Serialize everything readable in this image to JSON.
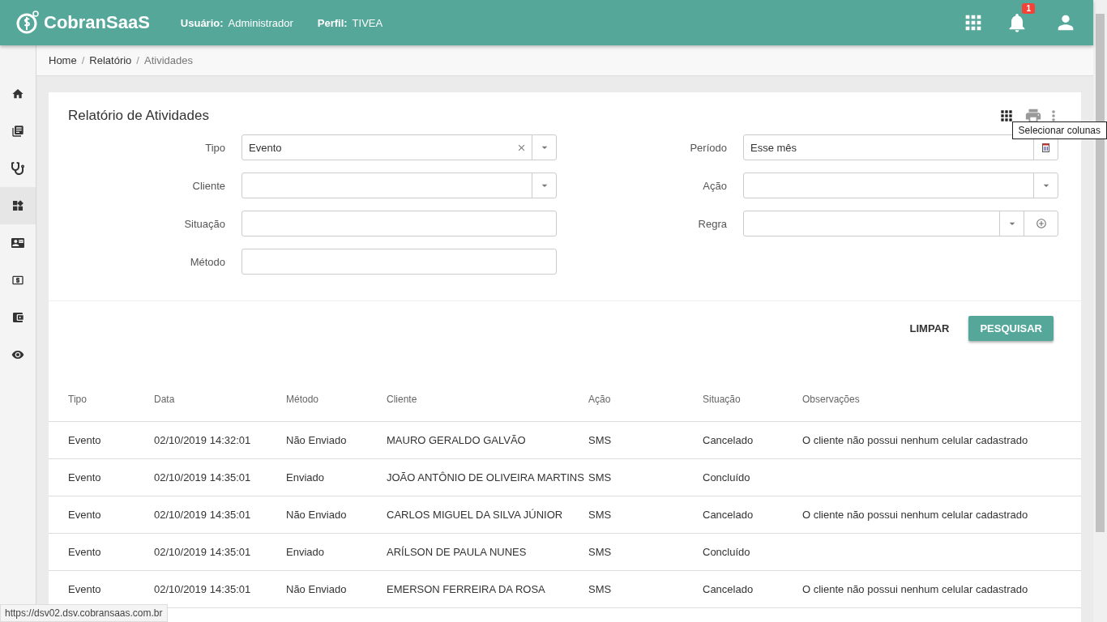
{
  "header": {
    "brand": "CobranSaaS",
    "user_label": "Usuário:",
    "user_value": "Administrador",
    "profile_label": "Perfil:",
    "profile_value": "TIVEA",
    "notification_count": "1"
  },
  "sidebar": {
    "items": [
      {
        "kind": "home",
        "selected": false
      },
      {
        "kind": "books",
        "selected": false
      },
      {
        "kind": "stethoscope",
        "selected": false
      },
      {
        "kind": "widgets",
        "selected": true
      },
      {
        "kind": "contact",
        "selected": false
      },
      {
        "kind": "money",
        "selected": false
      },
      {
        "kind": "wallet",
        "selected": false
      },
      {
        "kind": "eye",
        "selected": false
      }
    ]
  },
  "breadcrumb": {
    "separator": "/",
    "items": [
      "Home",
      "Relatório",
      "Atividades"
    ]
  },
  "card": {
    "title": "Relatório de Atividades",
    "tooltip": "Selecionar colunas"
  },
  "filters_left": [
    {
      "label": "Tipo",
      "kind": "select",
      "value": "Evento",
      "clearable": true
    },
    {
      "label": "Cliente",
      "kind": "select"
    },
    {
      "label": "Situação",
      "kind": "text"
    },
    {
      "label": "Método",
      "kind": "text"
    }
  ],
  "filters_right": [
    {
      "label": "Período",
      "kind": "date",
      "value": "Esse mês"
    },
    {
      "label": "Ação",
      "kind": "select"
    },
    {
      "label": "Regra",
      "kind": "select-add"
    }
  ],
  "buttons": {
    "clear": "LIMPAR",
    "search": "PESQUISAR"
  },
  "table": {
    "columns": [
      "Tipo",
      "Data",
      "Método",
      "Cliente",
      "Ação",
      "Situação",
      "Observações"
    ],
    "rows": [
      [
        "Evento",
        "02/10/2019 14:32:01",
        "Não Enviado",
        "MAURO GERALDO GALVÃO",
        "SMS",
        "Cancelado",
        "O cliente não possui nenhum celular cadastrado"
      ],
      [
        "Evento",
        "02/10/2019 14:35:01",
        "Enviado",
        "JOÃO ANTÔNIO DE OLIVEIRA MARTINS",
        "SMS",
        "Concluído",
        ""
      ],
      [
        "Evento",
        "02/10/2019 14:35:01",
        "Não Enviado",
        "CARLOS MIGUEL DA SILVA JÚNIOR",
        "SMS",
        "Cancelado",
        "O cliente não possui nenhum celular cadastrado"
      ],
      [
        "Evento",
        "02/10/2019 14:35:01",
        "Enviado",
        "ARÍLSON DE PAULA NUNES",
        "SMS",
        "Concluído",
        ""
      ],
      [
        "Evento",
        "02/10/2019 14:35:01",
        "Não Enviado",
        "EMERSON FERREIRA DA ROSA",
        "SMS",
        "Cancelado",
        "O cliente não possui nenhum celular cadastrado"
      ]
    ]
  },
  "status_url": "https://dsv02.dsv.cobransaas.com.br"
}
